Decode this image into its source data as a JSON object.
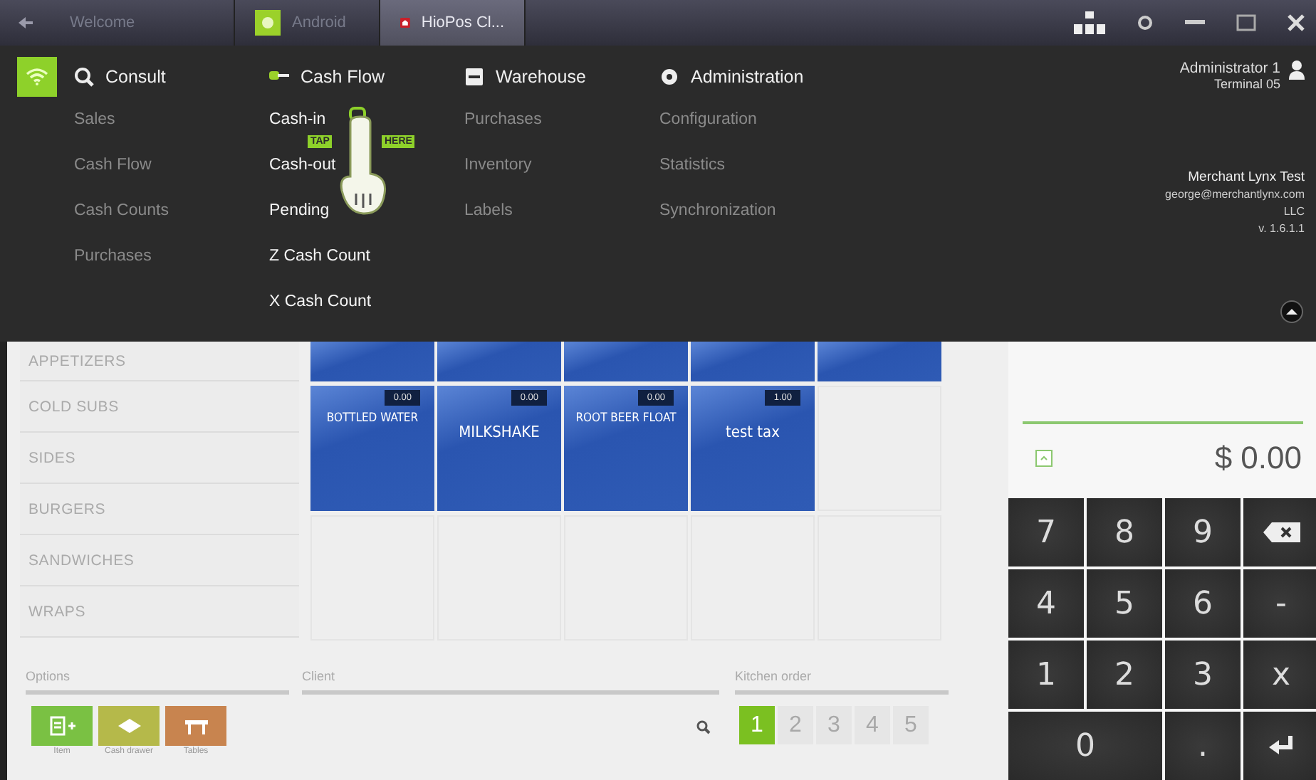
{
  "window": {
    "tabs": [
      {
        "label": "Welcome",
        "selected": false
      },
      {
        "label": "Android",
        "selected": false
      },
      {
        "label": "HioPos Cl...",
        "selected": true
      }
    ]
  },
  "menu": {
    "columns": [
      {
        "title": "Consult",
        "active": false,
        "items": [
          "Sales",
          "Cash Flow",
          "Cash Counts",
          "Purchases"
        ]
      },
      {
        "title": "Cash Flow",
        "active": true,
        "items": [
          "Cash-in",
          "Cash-out",
          "Pending",
          "Z Cash Count",
          "X Cash Count"
        ]
      },
      {
        "title": "Warehouse",
        "active": false,
        "items": [
          "Purchases",
          "Inventory",
          "Labels"
        ]
      },
      {
        "title": "Administration",
        "active": false,
        "items": [
          "Configuration",
          "Statistics",
          "Synchronization"
        ]
      }
    ],
    "user": {
      "name": "Administrator 1",
      "terminal": "Terminal 05"
    },
    "merchant": [
      "Merchant Lynx Test",
      "george@merchantlynx.com",
      "LLC",
      "v. 1.6.1.1"
    ],
    "tap_hint": {
      "left": "TAP",
      "right": "HERE"
    }
  },
  "categories": [
    "APPETIZERS",
    "COLD SUBS",
    "SIDES",
    "BURGERS",
    "SANDWICHES",
    "WRAPS"
  ],
  "products": [
    [
      {
        "kind": "product"
      },
      {
        "kind": "product"
      },
      {
        "kind": "product"
      },
      {
        "kind": "product"
      },
      {
        "kind": "product"
      }
    ],
    [
      {
        "kind": "product",
        "price": "0.00",
        "name": "BOTTLED WATER"
      },
      {
        "kind": "product",
        "price": "0.00",
        "name": "MILKSHAKE"
      },
      {
        "kind": "product",
        "price": "0.00",
        "name": "ROOT BEER FLOAT"
      },
      {
        "kind": "product",
        "price": "1.00",
        "name": "test tax"
      },
      {
        "kind": "empty"
      }
    ],
    [
      {
        "kind": "empty"
      },
      {
        "kind": "empty"
      },
      {
        "kind": "empty"
      },
      {
        "kind": "empty"
      },
      {
        "kind": "empty"
      }
    ]
  ],
  "options": {
    "label": "Options",
    "buttons": [
      {
        "label": "Item",
        "color": "#7ac143"
      },
      {
        "label": "Cash drawer",
        "color": "#b5b94a"
      },
      {
        "label": "Tables",
        "color": "#c8844f"
      }
    ]
  },
  "client": {
    "label": "Client"
  },
  "kitchen_order": {
    "label": "Kitchen order",
    "pages": [
      {
        "label": "1",
        "selected": true
      },
      {
        "label": "2",
        "selected": false
      },
      {
        "label": "3",
        "selected": false
      },
      {
        "label": "4",
        "selected": false
      },
      {
        "label": "5",
        "selected": false
      }
    ]
  },
  "total": {
    "amount": "$ 0.00"
  },
  "keypad": [
    {
      "label": "7",
      "kind": "key"
    },
    {
      "label": "8",
      "kind": "key"
    },
    {
      "label": "9",
      "kind": "key"
    },
    {
      "kind": "backspace"
    },
    {
      "label": "4",
      "kind": "key"
    },
    {
      "label": "5",
      "kind": "key"
    },
    {
      "label": "6",
      "kind": "key"
    },
    {
      "label": "-",
      "kind": "key"
    },
    {
      "label": "1",
      "kind": "key"
    },
    {
      "label": "2",
      "kind": "key"
    },
    {
      "label": "3",
      "kind": "key"
    },
    {
      "label": "x",
      "kind": "key"
    },
    {
      "label": "0",
      "kind": "wide"
    },
    {
      "label": ".",
      "kind": "key"
    },
    {
      "kind": "enter"
    }
  ]
}
